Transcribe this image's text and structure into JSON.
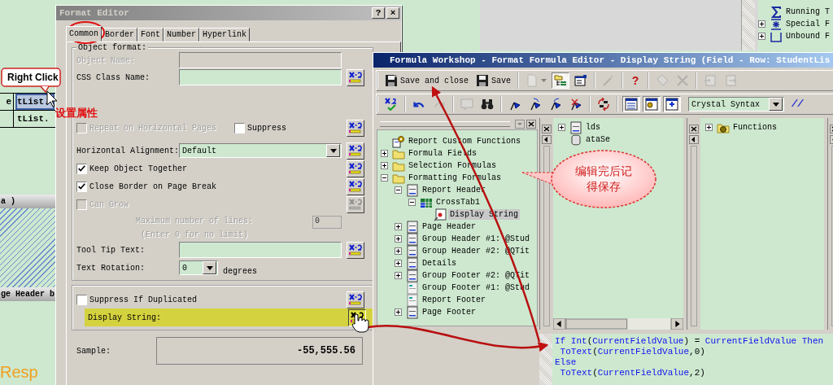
{
  "report_canvas": {
    "rows": [
      {
        "label": "e",
        "field": "tList.",
        "selected": true
      },
      {
        "field": "tList.",
        "selected": false
      }
    ],
    "section_label": "a )",
    "section_band": "ge Header b",
    "heading_text": "Resp"
  },
  "background_tree": {
    "items": [
      {
        "label": "Running T",
        "kind": "sigma"
      },
      {
        "label": "Special F",
        "kind": "special",
        "expanded": false
      },
      {
        "label": "Unbound F",
        "kind": "bracket",
        "expanded": false
      }
    ]
  },
  "format_editor": {
    "title": "Format Editor",
    "help_button": "?",
    "close_button": "×",
    "tabs": [
      {
        "label": "Common",
        "selected": true
      },
      {
        "label": "Border",
        "selected": false
      },
      {
        "label": "Font",
        "selected": false
      },
      {
        "label": "Number",
        "selected": false
      },
      {
        "label": "Hyperlink",
        "selected": false
      }
    ],
    "group_label": "Object format:",
    "rows": [
      {
        "kind": "text_field",
        "label": "Object Name:",
        "disabled": true
      },
      {
        "kind": "text_field",
        "label": "CSS Class Name:",
        "disabled": false,
        "formula": {
          "disabled": false,
          "highlighted": false
        }
      },
      {
        "kind": "checkbox_pair",
        "items": [
          {
            "label": "Repeat on Horizontal Pages",
            "checked": false,
            "disabled": true
          },
          {
            "label": "Suppress",
            "checked": false,
            "disabled": false
          }
        ],
        "formula": {
          "disabled": false,
          "highlighted": false
        }
      },
      {
        "kind": "dropdown",
        "label": "Horizontal Alignment:",
        "value": "Default",
        "formula": {
          "disabled": false,
          "highlighted": false
        }
      },
      {
        "kind": "checkbox",
        "label": "Keep Object Together",
        "checked": true,
        "disabled": false,
        "formula": {
          "disabled": false,
          "highlighted": false
        }
      },
      {
        "kind": "checkbox",
        "label": "Close Border on Page Break",
        "checked": true,
        "disabled": false,
        "formula": {
          "disabled": false,
          "highlighted": false
        }
      },
      {
        "kind": "checkbox",
        "label": "Can Grow",
        "checked": false,
        "disabled": true,
        "formula": {
          "disabled": true,
          "highlighted": false
        }
      },
      {
        "kind": "max_lines",
        "label": "Maximum number of lines:",
        "hint": "(Enter 0 for no limit)",
        "value": "0",
        "disabled": true
      },
      {
        "kind": "text_field",
        "label": "Tool Tip Text:",
        "disabled": false,
        "formula": {
          "disabled": false,
          "highlighted": false
        }
      },
      {
        "kind": "rotation",
        "label": "Text Rotation:",
        "value": "0",
        "unit": "degrees"
      }
    ],
    "display_rows": [
      {
        "kind": "checkbox",
        "label": "Suppress If Duplicated",
        "checked": false,
        "disabled": false,
        "formula": {
          "disabled": false,
          "highlighted": false
        }
      },
      {
        "kind": "formula_label",
        "label": "Display String:",
        "highlighted": true,
        "formula": {
          "disabled": false,
          "highlighted": true
        }
      }
    ],
    "sample": {
      "label": "Sample:",
      "value": "-55,555.56"
    }
  },
  "formula_workshop": {
    "title": "Formula Workshop - Format Formula Editor - Display String (Field - Row: StudentLis",
    "toolbar_main": [
      [
        {
          "kind": "save_close",
          "label": "Save and close",
          "disabled": false,
          "pressed": false
        },
        {
          "kind": "save",
          "label": "Save",
          "disabled": false,
          "pressed": false
        }
      ],
      [
        {
          "kind": "new",
          "disabled": true,
          "pressed": false
        },
        {
          "kind": "tree_toggle",
          "disabled": false,
          "pressed": true
        },
        {
          "kind": "properties",
          "disabled": false,
          "pressed": false
        }
      ],
      [
        {
          "kind": "wand",
          "disabled": true,
          "pressed": false
        }
      ],
      [
        {
          "kind": "help",
          "label": "?",
          "disabled": false,
          "pressed": false
        }
      ],
      [
        {
          "kind": "rename",
          "disabled": true,
          "pressed": false
        },
        {
          "kind": "delete",
          "disabled": true,
          "pressed": false
        }
      ],
      [
        {
          "kind": "import",
          "disabled": true,
          "pressed": false
        },
        {
          "kind": "export",
          "disabled": true,
          "pressed": false
        }
      ]
    ],
    "toolbar_editor": [
      [
        {
          "kind": "check",
          "disabled": false,
          "pressed": false
        }
      ],
      [
        {
          "kind": "undo",
          "disabled": false,
          "pressed": false
        },
        {
          "kind": "redo",
          "disabled": true,
          "pressed": false
        }
      ],
      [
        {
          "kind": "comment",
          "disabled": true,
          "pressed": false
        },
        {
          "kind": "find",
          "disabled": false,
          "pressed": false
        }
      ],
      [
        {
          "kind": "bookmark",
          "disabled": false,
          "pressed": false
        },
        {
          "kind": "next_bookmark",
          "disabled": false,
          "pressed": false
        },
        {
          "kind": "prev_bookmark",
          "disabled": false,
          "pressed": false
        },
        {
          "kind": "clear_bookmarks",
          "disabled": false,
          "pressed": false
        }
      ],
      [
        {
          "kind": "sort",
          "disabled": false,
          "pressed": false
        }
      ],
      [
        {
          "kind": "panel_list",
          "disabled": false,
          "pressed": true
        },
        {
          "kind": "panel_gear",
          "disabled": false,
          "pressed": true
        },
        {
          "kind": "panel_plus",
          "disabled": false,
          "pressed": true
        }
      ]
    ],
    "syntax": "Crystal Syntax",
    "comment_button": "//",
    "tree": [
      {
        "label": "Report Custom Functions",
        "kind": "gear_doc",
        "selected": false
      },
      {
        "label": "Formula Fields",
        "kind": "folder",
        "selected": false,
        "expanded": false
      },
      {
        "label": "Selection Formulas",
        "kind": "folder",
        "selected": false,
        "expanded": false
      },
      {
        "label": "Formatting Formulas",
        "kind": "folder",
        "selected": false,
        "expanded": true,
        "children": [
          {
            "label": "Report Header",
            "kind": "section",
            "selected": false,
            "expanded": true,
            "children": [
              {
                "label": "CrossTab1",
                "kind": "crosstab",
                "selected": false,
                "expanded": true,
                "children": [
                  {
                    "label": "Display String",
                    "kind": "formula",
                    "selected": true
                  }
                ]
              }
            ]
          },
          {
            "label": "Page Header",
            "kind": "section",
            "selected": false,
            "expanded": false
          },
          {
            "label": "Group Header #1: @Stud",
            "kind": "section",
            "selected": false,
            "expanded": false
          },
          {
            "label": "Group Header #2: @QTit",
            "kind": "section",
            "selected": false,
            "expanded": false
          },
          {
            "label": "Details",
            "kind": "section",
            "selected": false,
            "expanded": false
          },
          {
            "label": "Group Footer #2: @QTit",
            "kind": "section",
            "selected": false,
            "expanded": false
          },
          {
            "label": "Group Footer #1: @Stud",
            "kind": "section_plain",
            "selected": false
          },
          {
            "label": "Report Footer",
            "kind": "section_plain",
            "selected": false
          },
          {
            "label": "Page Footer",
            "kind": "section",
            "selected": false,
            "expanded": false
          }
        ]
      }
    ],
    "field_tree": [
      {
        "label": "lds",
        "kind": "section",
        "expanded": false
      },
      {
        "label": "ataSe",
        "kind": "database"
      }
    ],
    "function_tree": [
      {
        "label": "Functions",
        "kind": "gear_folder",
        "expanded": false
      }
    ],
    "code": [
      [
        {
          "text": "If ",
          "kind": "keyword"
        },
        {
          "text": "Int",
          "kind": "keyword"
        },
        {
          "text": "(",
          "kind": "plain"
        },
        {
          "text": "CurrentFieldValue",
          "kind": "keyword"
        },
        {
          "text": ") = ",
          "kind": "plain"
        },
        {
          "text": "CurrentFieldValue ",
          "kind": "keyword"
        },
        {
          "text": "Then",
          "kind": "keyword"
        }
      ],
      [
        {
          "text": " ToText",
          "kind": "keyword"
        },
        {
          "text": "(",
          "kind": "plain"
        },
        {
          "text": "CurrentFieldValue",
          "kind": "keyword"
        },
        {
          "text": ",0)",
          "kind": "plain"
        }
      ],
      [
        {
          "text": "Else",
          "kind": "keyword"
        }
      ],
      [
        {
          "text": " ToText",
          "kind": "keyword"
        },
        {
          "text": "(",
          "kind": "plain"
        },
        {
          "text": "CurrentFieldValue",
          "kind": "keyword"
        },
        {
          "text": ",2)",
          "kind": "plain"
        }
      ]
    ]
  },
  "annotations": {
    "right_click": "Right Click",
    "properties_note": "设置属性",
    "save_reminder": "编辑完后记得保存"
  }
}
